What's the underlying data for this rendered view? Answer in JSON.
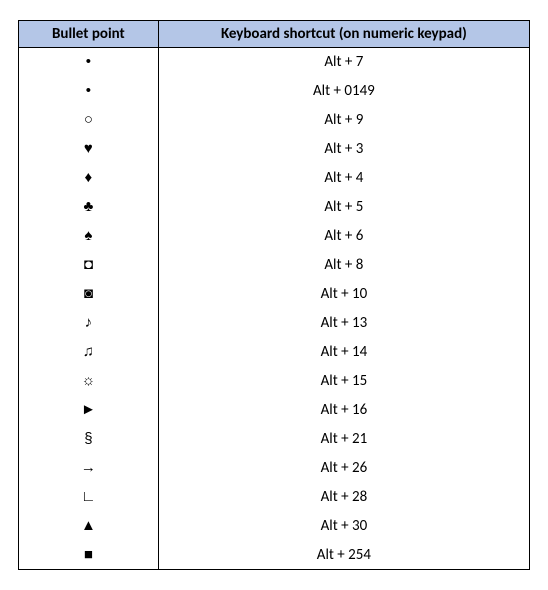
{
  "chart_data": {
    "type": "table",
    "title": "",
    "columns": [
      "Bullet point",
      "Keyboard shortcut (on numeric keypad)"
    ],
    "rows": [
      {
        "bullet": "•",
        "shortcut": "Alt + 7"
      },
      {
        "bullet": "•",
        "shortcut": "Alt + 0149"
      },
      {
        "bullet": "○",
        "shortcut": "Alt + 9"
      },
      {
        "bullet": "♥",
        "shortcut": "Alt + 3"
      },
      {
        "bullet": "♦",
        "shortcut": "Alt + 4"
      },
      {
        "bullet": "♣",
        "shortcut": "Alt + 5"
      },
      {
        "bullet": "♠",
        "shortcut": "Alt + 6"
      },
      {
        "bullet": "◘",
        "shortcut": "Alt + 8"
      },
      {
        "bullet": "◙",
        "shortcut": "Alt + 10"
      },
      {
        "bullet": "♪",
        "shortcut": "Alt + 13"
      },
      {
        "bullet": "♫",
        "shortcut": "Alt + 14"
      },
      {
        "bullet": "☼",
        "shortcut": "Alt + 15"
      },
      {
        "bullet": "►",
        "shortcut": "Alt + 16"
      },
      {
        "bullet": "§",
        "shortcut": "Alt + 21"
      },
      {
        "bullet": "→",
        "shortcut": "Alt + 26"
      },
      {
        "bullet": "∟",
        "shortcut": "Alt + 28"
      },
      {
        "bullet": "▲",
        "shortcut": "Alt + 30"
      },
      {
        "bullet": "■",
        "shortcut": "Alt + 254"
      }
    ]
  },
  "headers": {
    "bullet": "Bullet point",
    "shortcut": "Keyboard shortcut (on numeric keypad)"
  }
}
